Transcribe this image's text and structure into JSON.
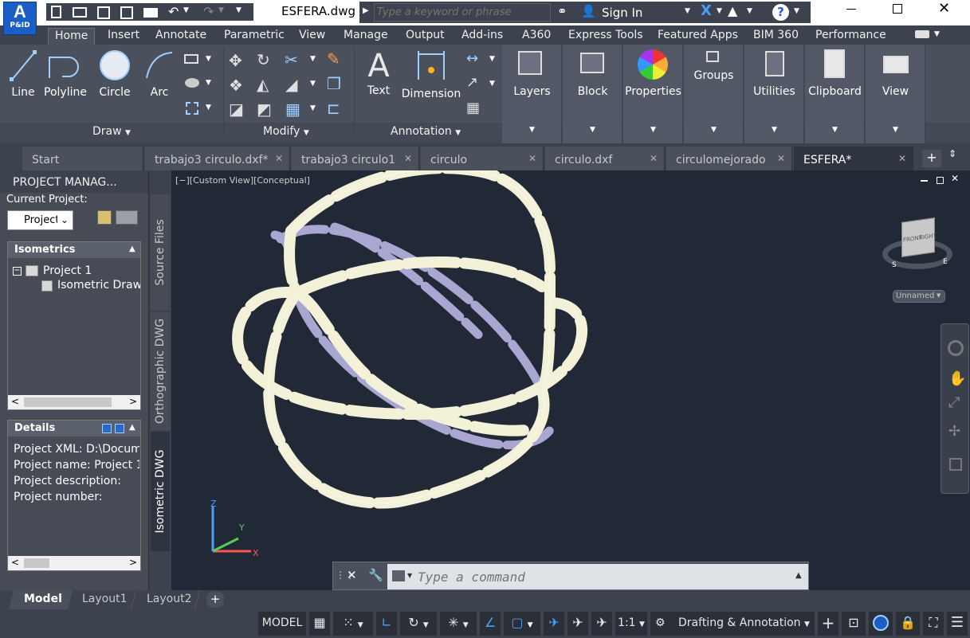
{
  "app": {
    "logo_text": "P&ID",
    "file_title": "ESFERA.dwg",
    "search_placeholder": "Type a keyword or phrase",
    "sign_in": "Sign In"
  },
  "ribbon_tabs": [
    "Home",
    "Insert",
    "Annotate",
    "Parametric",
    "View",
    "Manage",
    "Output",
    "Add-ins",
    "A360",
    "Express Tools",
    "Featured Apps",
    "BIM 360",
    "Performance"
  ],
  "ribbon": {
    "draw": {
      "line": "Line",
      "polyline": "Polyline",
      "circle": "Circle",
      "arc": "Arc",
      "group_label": "Draw"
    },
    "modify": {
      "group_label": "Modify"
    },
    "annotation": {
      "text": "Text",
      "dimension": "Dimension",
      "group_label": "Annotation"
    },
    "panels": {
      "layers": "Layers",
      "block": "Block",
      "properties": "Properties",
      "groups": "Groups",
      "utilities": "Utilities",
      "clipboard": "Clipboard",
      "view": "View"
    }
  },
  "doc_tabs": [
    {
      "label": "Start"
    },
    {
      "label": "trabajo3 circulo.dxf*"
    },
    {
      "label": "trabajo3 circulo1"
    },
    {
      "label": "circulo"
    },
    {
      "label": "circulo.dxf"
    },
    {
      "label": "circulomejorado"
    },
    {
      "label": "ESFERA*"
    }
  ],
  "project_manager": {
    "title": "PROJECT MANAG...",
    "current_project_label": "Current Project:",
    "project_select": "Project",
    "tree_header": "Isometrics",
    "tree_root": "Project 1",
    "tree_child": "Isometric Drawi",
    "details_header": "Details",
    "details": [
      "Project XML: D:\\Docum",
      "Project name: Project 1",
      "Project description:",
      "Project number:"
    ]
  },
  "side_tabs": {
    "source": "Source Files",
    "ortho": "Orthographic DWG",
    "iso": "Isometric DWG"
  },
  "viewport": {
    "label": "[−][Custom View][Conceptual]",
    "viewcube_front": "FRONT",
    "viewcube_right": "RIGHT",
    "compass_s": "S",
    "compass_e": "E",
    "ucs_name": "Unnamed",
    "axis_x": "X",
    "axis_y": "Y",
    "axis_z": "Z"
  },
  "command_line": {
    "placeholder": "Type a command"
  },
  "layout_tabs": [
    "Model",
    "Layout1",
    "Layout2"
  ],
  "status": {
    "model": "MODEL",
    "scale": "1:1",
    "workspace": "Drafting & Annotation"
  },
  "colors": {
    "accent": "#1b5ec5",
    "ribbon": "#4a505c",
    "viewport": "#212836",
    "sphere_light": "#f3f1d8",
    "sphere_shade": "#a9a6d1"
  }
}
